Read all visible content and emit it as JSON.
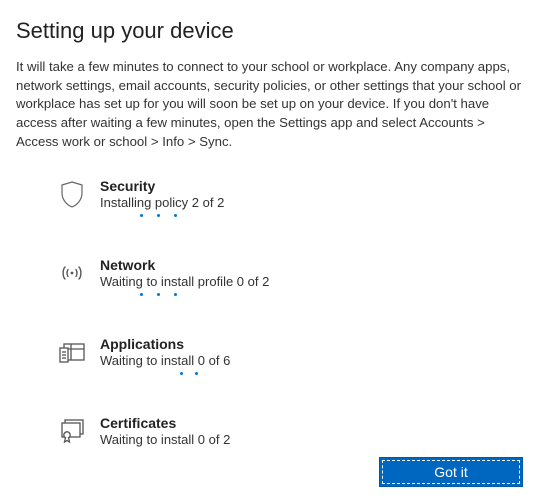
{
  "title": "Setting up your device",
  "description": "It will take a few minutes to connect to your school or workplace. Any company apps, network settings, email accounts, security policies, or other settings that your school or workplace has set up for you will soon be set up on your device. If you don't have access after waiting a few minutes, open the Settings app and select Accounts > Access work or school > Info > Sync.",
  "items": {
    "security": {
      "title": "Security",
      "status": "Installing policy 2 of 2"
    },
    "network": {
      "title": "Network",
      "status": "Waiting to install profile 0 of 2"
    },
    "applications": {
      "title": "Applications",
      "status": "Waiting to install 0 of 6"
    },
    "certificates": {
      "title": "Certificates",
      "status": "Waiting to install 0 of 2"
    }
  },
  "footer": {
    "button": "Got it"
  }
}
